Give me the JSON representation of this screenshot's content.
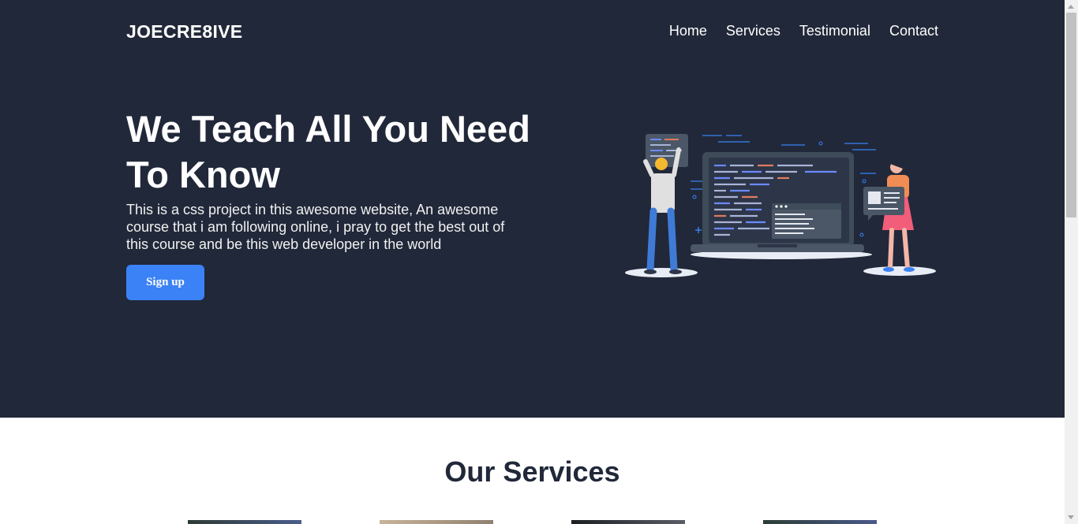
{
  "header": {
    "logo": "JOECRE8IVE",
    "nav": [
      "Home",
      "Services",
      "Testimonial",
      "Contact"
    ]
  },
  "hero": {
    "title_line1": "We Teach All You Need",
    "title_line2": "To Know",
    "description": "This is a css project in this awesome website, An awesome course that i am following online, i pray to get the best out of this course and be this web developer in the world",
    "cta": "Sign up"
  },
  "services": {
    "title": "Our Services"
  },
  "colors": {
    "hero_bg": "#212839",
    "accent": "#3b82f6",
    "text_dark": "#212839"
  }
}
